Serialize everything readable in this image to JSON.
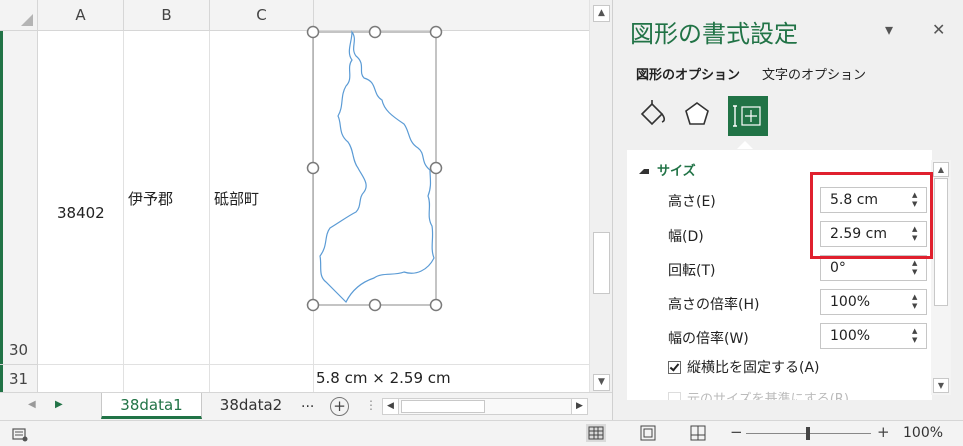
{
  "sheet": {
    "columns": [
      "A",
      "B",
      "C"
    ],
    "rows": [
      {
        "num": "30"
      },
      {
        "num": "31"
      }
    ],
    "cells": {
      "a": "38402",
      "b": "伊予郡",
      "c": "砥部町"
    },
    "shape_size_tooltip": "5.8 cm × 2.59 cm",
    "tabs": {
      "active": "38data1",
      "inactive": "38data2",
      "more": "...",
      "add": "+",
      "sep": "⋮"
    }
  },
  "pane": {
    "title": "図形の書式設定",
    "tabs": [
      "図形のオプション",
      "文字のオプション"
    ],
    "section": "サイズ",
    "properties": [
      {
        "label": "高さ(E)",
        "value": "5.8 cm"
      },
      {
        "label": "幅(D)",
        "value": "2.59 cm"
      },
      {
        "label": "回転(T)",
        "value": "0°"
      },
      {
        "label": "高さの倍率(H)",
        "value": "100%"
      },
      {
        "label": "幅の倍率(W)",
        "value": "100%"
      }
    ],
    "lock_aspect": {
      "label": "縦横比を固定する(A)",
      "checked": true
    },
    "faded_label": "元のサイズを基準にする(R)",
    "icons": [
      "fill-line-icon",
      "effects-pentagon-icon",
      "size-properties-icon"
    ],
    "close": "✕",
    "menu": "▾"
  },
  "status": {
    "zoom": "100%",
    "zoom_minus": "−",
    "zoom_plus": "+"
  },
  "colors": {
    "excel_green": "#217346",
    "highlight_red": "#e0202e",
    "outline_blue": "#5b9bd5"
  }
}
